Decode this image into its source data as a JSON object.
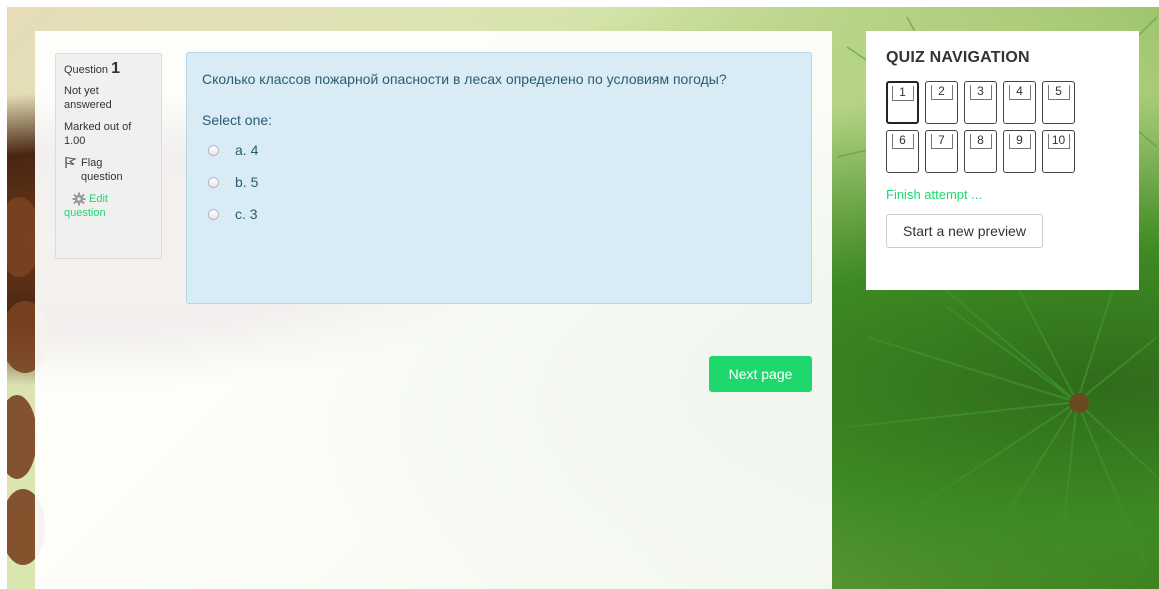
{
  "question_info": {
    "label": "Question",
    "number": "1",
    "state_line1": "Not yet",
    "state_line2": "answered",
    "grade_line1": "Marked out of",
    "grade_line2": "1.00",
    "flag_line1": "Flag",
    "flag_line2": "question",
    "edit_line1": "Edit",
    "edit_line2": "question"
  },
  "question": {
    "text": "Сколько классов пожарной опасности в лесах определено по условиям погоды?",
    "prompt": "Select one:",
    "answers": [
      {
        "label": "a. 4"
      },
      {
        "label": "b. 5"
      },
      {
        "label": "c. 3"
      }
    ]
  },
  "next_button": "Next page",
  "nav": {
    "title": "QUIZ NAVIGATION",
    "questions": [
      "1",
      "2",
      "3",
      "4",
      "5",
      "6",
      "7",
      "8",
      "9",
      "10"
    ],
    "current": "1",
    "finish_link": "Finish attempt ...",
    "preview_button": "Start a new preview"
  },
  "colors": {
    "accent_green": "#1ed76d",
    "question_bg": "#d9ecf5",
    "question_text": "#2c5b74"
  }
}
